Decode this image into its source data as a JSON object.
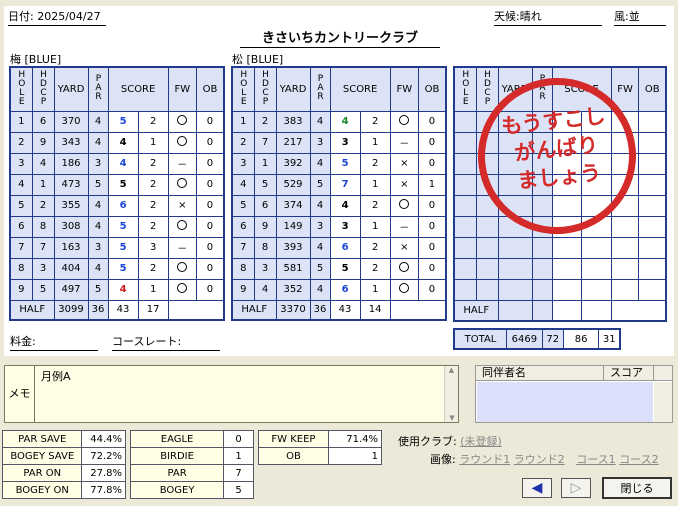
{
  "header": {
    "date_label": "日付:",
    "date": "2025/04/27",
    "weather_label": "天候:",
    "weather": "晴れ",
    "wind_label": "風:",
    "wind": "並"
  },
  "course_title": "きさいちカントリークラブ",
  "columns": {
    "hole": "HOLE",
    "hdcp": "HDCP",
    "yard": "YARD",
    "par": "PAR",
    "score": "SCORE",
    "fw": "FW",
    "ob": "OB",
    "half": "HALF",
    "total": "TOTAL"
  },
  "front": {
    "name": "梅 [BLUE]",
    "rows": [
      {
        "hole": "1",
        "hdcp": "6",
        "yard": "370",
        "par": "4",
        "score": "5",
        "score_color": "blue",
        "putt": "2",
        "fw": "○",
        "ob": "0"
      },
      {
        "hole": "2",
        "hdcp": "9",
        "yard": "343",
        "par": "4",
        "score": "4",
        "score_color": "black",
        "putt": "1",
        "fw": "○",
        "ob": "0"
      },
      {
        "hole": "3",
        "hdcp": "4",
        "yard": "186",
        "par": "3",
        "score": "4",
        "score_color": "blue",
        "putt": "2",
        "fw": "－",
        "ob": "0"
      },
      {
        "hole": "4",
        "hdcp": "1",
        "yard": "473",
        "par": "5",
        "score": "5",
        "score_color": "black",
        "putt": "2",
        "fw": "○",
        "ob": "0"
      },
      {
        "hole": "5",
        "hdcp": "2",
        "yard": "355",
        "par": "4",
        "score": "6",
        "score_color": "blue",
        "putt": "2",
        "fw": "×",
        "ob": "0"
      },
      {
        "hole": "6",
        "hdcp": "8",
        "yard": "308",
        "par": "4",
        "score": "5",
        "score_color": "blue",
        "putt": "2",
        "fw": "○",
        "ob": "0"
      },
      {
        "hole": "7",
        "hdcp": "7",
        "yard": "163",
        "par": "3",
        "score": "5",
        "score_color": "blue",
        "putt": "3",
        "fw": "－",
        "ob": "0"
      },
      {
        "hole": "8",
        "hdcp": "3",
        "yard": "404",
        "par": "4",
        "score": "5",
        "score_color": "blue",
        "putt": "2",
        "fw": "○",
        "ob": "0"
      },
      {
        "hole": "9",
        "hdcp": "5",
        "yard": "497",
        "par": "5",
        "score": "4",
        "score_color": "red",
        "putt": "1",
        "fw": "○",
        "ob": "0"
      }
    ],
    "half": {
      "yard": "3099",
      "par": "36",
      "score": "43",
      "putt": "17"
    }
  },
  "back": {
    "name": "松 [BLUE]",
    "rows": [
      {
        "hole": "1",
        "hdcp": "2",
        "yard": "383",
        "par": "4",
        "score": "4",
        "score_color": "green",
        "putt": "2",
        "fw": "○",
        "ob": "0"
      },
      {
        "hole": "2",
        "hdcp": "7",
        "yard": "217",
        "par": "3",
        "score": "3",
        "score_color": "black",
        "putt": "1",
        "fw": "－",
        "ob": "0"
      },
      {
        "hole": "3",
        "hdcp": "1",
        "yard": "392",
        "par": "4",
        "score": "5",
        "score_color": "blue",
        "putt": "2",
        "fw": "×",
        "ob": "0"
      },
      {
        "hole": "4",
        "hdcp": "5",
        "yard": "529",
        "par": "5",
        "score": "7",
        "score_color": "blue",
        "putt": "1",
        "fw": "×",
        "ob": "1"
      },
      {
        "hole": "5",
        "hdcp": "6",
        "yard": "374",
        "par": "4",
        "score": "4",
        "score_color": "black",
        "putt": "2",
        "fw": "○",
        "ob": "0"
      },
      {
        "hole": "6",
        "hdcp": "9",
        "yard": "149",
        "par": "3",
        "score": "3",
        "score_color": "black",
        "putt": "1",
        "fw": "－",
        "ob": "0"
      },
      {
        "hole": "7",
        "hdcp": "8",
        "yard": "393",
        "par": "4",
        "score": "6",
        "score_color": "blue",
        "putt": "2",
        "fw": "×",
        "ob": "0"
      },
      {
        "hole": "8",
        "hdcp": "3",
        "yard": "581",
        "par": "5",
        "score": "5",
        "score_color": "black",
        "putt": "2",
        "fw": "○",
        "ob": "0"
      },
      {
        "hole": "9",
        "hdcp": "4",
        "yard": "352",
        "par": "4",
        "score": "6",
        "score_color": "blue",
        "putt": "1",
        "fw": "○",
        "ob": "0"
      }
    ],
    "half": {
      "yard": "3370",
      "par": "36",
      "score": "43",
      "putt": "14"
    }
  },
  "total": {
    "yard": "6469",
    "par": "72",
    "score": "86",
    "putt": "31"
  },
  "stamp": {
    "line1": "もうすこし",
    "line2": "がんばり",
    "line3": "ましょう"
  },
  "fee_label": "料金:",
  "course_rate_label": "コースレート:",
  "memo": {
    "label": "メモ",
    "text": "月例A"
  },
  "companions": {
    "name_header": "同伴者名",
    "score_header": "スコア"
  },
  "stats": {
    "left": [
      {
        "label": "PAR SAVE",
        "value": "44.4%"
      },
      {
        "label": "BOGEY SAVE",
        "value": "72.2%"
      },
      {
        "label": "PAR ON",
        "value": "27.8%"
      },
      {
        "label": "BOGEY ON",
        "value": "77.8%"
      }
    ],
    "middle": [
      {
        "label": "EAGLE",
        "value": "0"
      },
      {
        "label": "BIRDIE",
        "value": "1"
      },
      {
        "label": "PAR",
        "value": "7"
      },
      {
        "label": "BOGEY",
        "value": "5"
      }
    ],
    "right": [
      {
        "label": "FW KEEP",
        "value": "71.4%"
      },
      {
        "label": "OB",
        "value": "1"
      }
    ]
  },
  "clubs": {
    "label": "使用クラブ:",
    "value": "(未登録)"
  },
  "images": {
    "label": "画像:",
    "round1": "ラウンド1",
    "round2": "ラウンド2",
    "course1": "コース1",
    "course2": "コース2"
  },
  "buttons": {
    "close": "閉じる"
  },
  "colors": {
    "grid": "#223a8c",
    "header_fill": "#dde3f6",
    "stamp": "#d42a2a",
    "memo_bg": "#ffffe6"
  }
}
